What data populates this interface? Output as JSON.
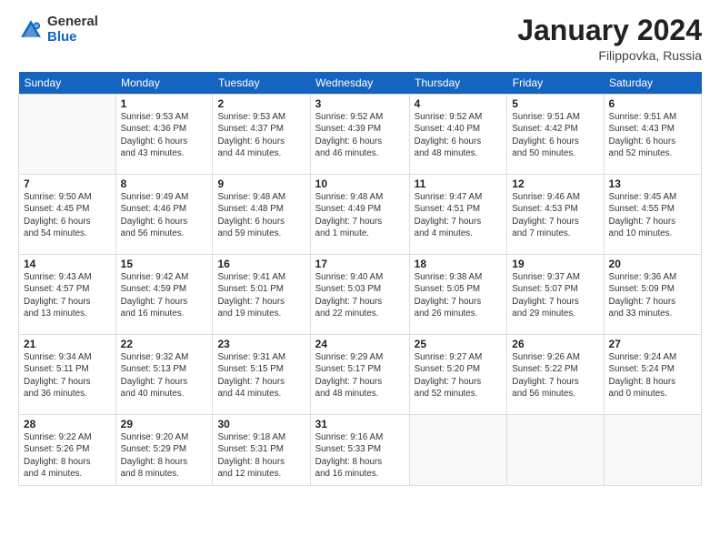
{
  "logo": {
    "general": "General",
    "blue": "Blue"
  },
  "title": "January 2024",
  "location": "Filippovka, Russia",
  "days_header": [
    "Sunday",
    "Monday",
    "Tuesday",
    "Wednesday",
    "Thursday",
    "Friday",
    "Saturday"
  ],
  "weeks": [
    [
      {
        "day": "",
        "info": ""
      },
      {
        "day": "1",
        "info": "Sunrise: 9:53 AM\nSunset: 4:36 PM\nDaylight: 6 hours\nand 43 minutes."
      },
      {
        "day": "2",
        "info": "Sunrise: 9:53 AM\nSunset: 4:37 PM\nDaylight: 6 hours\nand 44 minutes."
      },
      {
        "day": "3",
        "info": "Sunrise: 9:52 AM\nSunset: 4:39 PM\nDaylight: 6 hours\nand 46 minutes."
      },
      {
        "day": "4",
        "info": "Sunrise: 9:52 AM\nSunset: 4:40 PM\nDaylight: 6 hours\nand 48 minutes."
      },
      {
        "day": "5",
        "info": "Sunrise: 9:51 AM\nSunset: 4:42 PM\nDaylight: 6 hours\nand 50 minutes."
      },
      {
        "day": "6",
        "info": "Sunrise: 9:51 AM\nSunset: 4:43 PM\nDaylight: 6 hours\nand 52 minutes."
      }
    ],
    [
      {
        "day": "7",
        "info": "Sunrise: 9:50 AM\nSunset: 4:45 PM\nDaylight: 6 hours\nand 54 minutes."
      },
      {
        "day": "8",
        "info": "Sunrise: 9:49 AM\nSunset: 4:46 PM\nDaylight: 6 hours\nand 56 minutes."
      },
      {
        "day": "9",
        "info": "Sunrise: 9:48 AM\nSunset: 4:48 PM\nDaylight: 6 hours\nand 59 minutes."
      },
      {
        "day": "10",
        "info": "Sunrise: 9:48 AM\nSunset: 4:49 PM\nDaylight: 7 hours\nand 1 minute."
      },
      {
        "day": "11",
        "info": "Sunrise: 9:47 AM\nSunset: 4:51 PM\nDaylight: 7 hours\nand 4 minutes."
      },
      {
        "day": "12",
        "info": "Sunrise: 9:46 AM\nSunset: 4:53 PM\nDaylight: 7 hours\nand 7 minutes."
      },
      {
        "day": "13",
        "info": "Sunrise: 9:45 AM\nSunset: 4:55 PM\nDaylight: 7 hours\nand 10 minutes."
      }
    ],
    [
      {
        "day": "14",
        "info": "Sunrise: 9:43 AM\nSunset: 4:57 PM\nDaylight: 7 hours\nand 13 minutes."
      },
      {
        "day": "15",
        "info": "Sunrise: 9:42 AM\nSunset: 4:59 PM\nDaylight: 7 hours\nand 16 minutes."
      },
      {
        "day": "16",
        "info": "Sunrise: 9:41 AM\nSunset: 5:01 PM\nDaylight: 7 hours\nand 19 minutes."
      },
      {
        "day": "17",
        "info": "Sunrise: 9:40 AM\nSunset: 5:03 PM\nDaylight: 7 hours\nand 22 minutes."
      },
      {
        "day": "18",
        "info": "Sunrise: 9:38 AM\nSunset: 5:05 PM\nDaylight: 7 hours\nand 26 minutes."
      },
      {
        "day": "19",
        "info": "Sunrise: 9:37 AM\nSunset: 5:07 PM\nDaylight: 7 hours\nand 29 minutes."
      },
      {
        "day": "20",
        "info": "Sunrise: 9:36 AM\nSunset: 5:09 PM\nDaylight: 7 hours\nand 33 minutes."
      }
    ],
    [
      {
        "day": "21",
        "info": "Sunrise: 9:34 AM\nSunset: 5:11 PM\nDaylight: 7 hours\nand 36 minutes."
      },
      {
        "day": "22",
        "info": "Sunrise: 9:32 AM\nSunset: 5:13 PM\nDaylight: 7 hours\nand 40 minutes."
      },
      {
        "day": "23",
        "info": "Sunrise: 9:31 AM\nSunset: 5:15 PM\nDaylight: 7 hours\nand 44 minutes."
      },
      {
        "day": "24",
        "info": "Sunrise: 9:29 AM\nSunset: 5:17 PM\nDaylight: 7 hours\nand 48 minutes."
      },
      {
        "day": "25",
        "info": "Sunrise: 9:27 AM\nSunset: 5:20 PM\nDaylight: 7 hours\nand 52 minutes."
      },
      {
        "day": "26",
        "info": "Sunrise: 9:26 AM\nSunset: 5:22 PM\nDaylight: 7 hours\nand 56 minutes."
      },
      {
        "day": "27",
        "info": "Sunrise: 9:24 AM\nSunset: 5:24 PM\nDaylight: 8 hours\nand 0 minutes."
      }
    ],
    [
      {
        "day": "28",
        "info": "Sunrise: 9:22 AM\nSunset: 5:26 PM\nDaylight: 8 hours\nand 4 minutes."
      },
      {
        "day": "29",
        "info": "Sunrise: 9:20 AM\nSunset: 5:29 PM\nDaylight: 8 hours\nand 8 minutes."
      },
      {
        "day": "30",
        "info": "Sunrise: 9:18 AM\nSunset: 5:31 PM\nDaylight: 8 hours\nand 12 minutes."
      },
      {
        "day": "31",
        "info": "Sunrise: 9:16 AM\nSunset: 5:33 PM\nDaylight: 8 hours\nand 16 minutes."
      },
      {
        "day": "",
        "info": ""
      },
      {
        "day": "",
        "info": ""
      },
      {
        "day": "",
        "info": ""
      }
    ]
  ]
}
